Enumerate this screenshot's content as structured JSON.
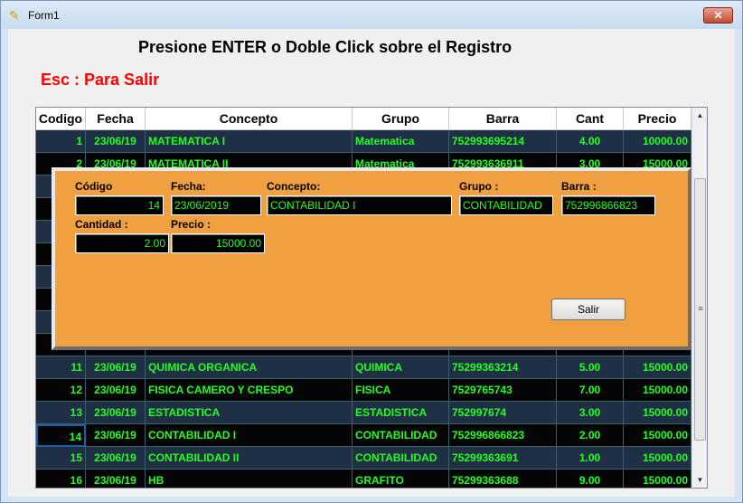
{
  "window": {
    "title": "Form1",
    "close_glyph": "✕"
  },
  "header": {
    "instruction": "Presione ENTER  o Doble Click sobre el Registro",
    "escape_hint": "Esc : Para Salir"
  },
  "grid": {
    "columns": [
      "Codigo",
      "Fecha",
      "Concepto",
      "Grupo",
      "Barra",
      "Cant",
      "Precio"
    ],
    "rows": [
      [
        "1",
        "23/06/19",
        "MATEMATICA I",
        "Matematica",
        "752993695214",
        "4.00",
        "10000.00"
      ],
      [
        "2",
        "23/06/19",
        "MATEMATICA II",
        "Matematica",
        "752993636911",
        "3.00",
        "15000.00"
      ],
      [
        "",
        "",
        "",
        "",
        "",
        "",
        ""
      ],
      [
        "",
        "",
        "",
        "",
        "",
        "",
        ""
      ],
      [
        "",
        "",
        "",
        "",
        "",
        "",
        ""
      ],
      [
        "",
        "",
        "",
        "",
        "",
        "",
        ""
      ],
      [
        "",
        "",
        "",
        "",
        "",
        "",
        ""
      ],
      [
        "",
        "",
        "",
        "",
        "",
        "",
        ""
      ],
      [
        "",
        "",
        "",
        "",
        "",
        "",
        ""
      ],
      [
        "",
        "",
        "",
        "",
        "",
        "",
        ""
      ],
      [
        "11",
        "23/06/19",
        "QUIMICA ORGANICA",
        "QUIMICA",
        "75299363214",
        "5.00",
        "15000.00"
      ],
      [
        "12",
        "23/06/19",
        "FISICA CAMERO Y CRESPO",
        "FISICA",
        "7529765743",
        "7.00",
        "15000.00"
      ],
      [
        "13",
        "23/06/19",
        "ESTADISTICA",
        "ESTADISTICA",
        "752997674",
        "3.00",
        "15000.00"
      ],
      [
        "14",
        "23/06/19",
        "CONTABILIDAD I",
        "CONTABILIDAD",
        "752996866823",
        "2.00",
        "15000.00"
      ],
      [
        "15",
        "23/06/19",
        "CONTABILIDAD II",
        "CONTABILIDAD",
        "75299363691",
        "1.00",
        "15000.00"
      ],
      [
        "16",
        "23/06/19",
        "HB",
        "GRAFITO",
        "75299363688",
        "9.00",
        "15000.00"
      ]
    ],
    "selected_row": 13
  },
  "scrollbar": {
    "up_glyph": "▲",
    "down_glyph": "▼",
    "grip_glyph": "≡"
  },
  "detail": {
    "codigo_label": "Código",
    "codigo_value": "14",
    "fecha_label": "Fecha:",
    "fecha_value": "23/06/2019",
    "concepto_label": "Concepto:",
    "concepto_value": "CONTABILIDAD I",
    "grupo_label": "Grupo :",
    "grupo_value": "CONTABILIDAD",
    "barra_label": "Barra :",
    "barra_value": "752996866823",
    "cantidad_label": "Cantidad :",
    "cantidad_value": "2.00",
    "precio_label": "Precio :",
    "precio_value": "15000.00",
    "salir_label": "Salir"
  },
  "colors": {
    "grid_text": "#20ff20",
    "row_dark_blue": "#1f2f44",
    "row_black": "#050505",
    "panel_bg": "#f0a040",
    "escape_hint": "#ff0000"
  }
}
